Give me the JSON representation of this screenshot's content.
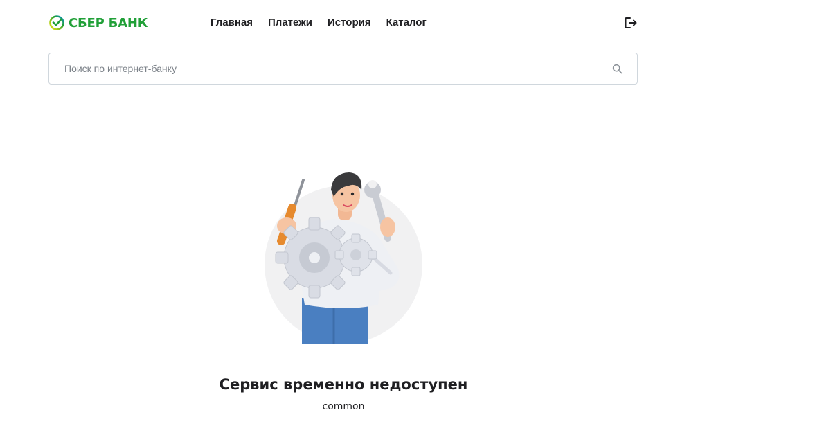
{
  "header": {
    "logo_text": "СБЕР БАНК",
    "nav": [
      {
        "label": "Главная"
      },
      {
        "label": "Платежи"
      },
      {
        "label": "История"
      },
      {
        "label": "Каталог"
      }
    ],
    "logout_icon": "logout-icon"
  },
  "search": {
    "placeholder": "Поиск по интернет-банку",
    "value": "",
    "icon": "search-icon"
  },
  "error": {
    "illustration": "mechanic-with-gears-illustration",
    "title": "Сервис временно недоступен",
    "code": "common"
  },
  "colors": {
    "brand": "#21a038",
    "text": "#1f1f22",
    "border": "#d0d7dd",
    "placeholder": "#7d838a"
  }
}
